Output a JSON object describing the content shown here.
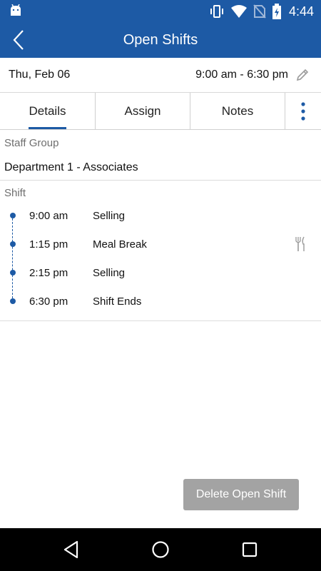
{
  "status_bar": {
    "time": "4:44",
    "icons": [
      "android-icon",
      "vibrate-icon",
      "wifi-icon",
      "no-sim-icon",
      "battery-charging-icon"
    ]
  },
  "app_bar": {
    "title": "Open Shifts",
    "back_icon": "chevron-left-icon"
  },
  "shift_header": {
    "date": "Thu, Feb 06",
    "time_range": "9:00 am - 6:30 pm",
    "edit_icon": "pencil-icon"
  },
  "tabs": [
    {
      "label": "Details",
      "active": true
    },
    {
      "label": "Assign",
      "active": false
    },
    {
      "label": "Notes",
      "active": false
    }
  ],
  "details": {
    "staff_group_label": "Staff Group",
    "staff_group_value": "Department 1 - Associates",
    "shift_label": "Shift",
    "timeline": [
      {
        "time": "9:00 am",
        "activity": "Selling",
        "icon": ""
      },
      {
        "time": "1:15 pm",
        "activity": "Meal Break",
        "icon": "fork-knife-icon"
      },
      {
        "time": "2:15 pm",
        "activity": "Selling",
        "icon": ""
      },
      {
        "time": "6:30 pm",
        "activity": "Shift Ends",
        "icon": ""
      }
    ]
  },
  "actions": {
    "delete_label": "Delete Open Shift"
  },
  "colors": {
    "brand": "#1d5aa5",
    "button_disabled": "#a3a3a3",
    "nav_bar": "#000000"
  }
}
